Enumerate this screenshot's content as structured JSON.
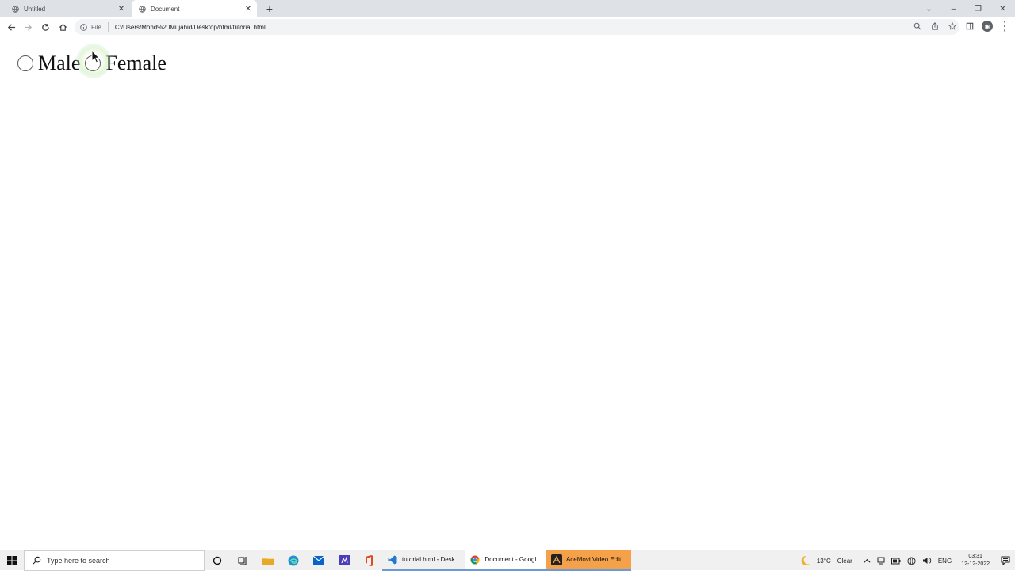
{
  "browser": {
    "tabs": [
      {
        "title": "Untitled",
        "active": false
      },
      {
        "title": "Document",
        "active": true
      }
    ],
    "address": {
      "scheme_label": "File",
      "url": "C:/Users/Mohd%20Mujahid/Desktop/html/tutorial.html"
    }
  },
  "page": {
    "radio_options": [
      {
        "label": "Male",
        "checked": false
      },
      {
        "label": "Female",
        "checked": false
      }
    ]
  },
  "taskbar": {
    "search_placeholder": "Type here to search",
    "apps": [
      {
        "label": "tutorial.html - Desk...",
        "icon": "vscode-icon"
      },
      {
        "label": "Document - Googl...",
        "icon": "chrome-icon"
      },
      {
        "label": "AceMovi Video Edit...",
        "icon": "acemovi-icon"
      }
    ],
    "weather": {
      "temp": "13°C",
      "condition": "Clear"
    },
    "lang": "ENG",
    "time": "03:31",
    "date": "12-12-2022"
  },
  "colors": {
    "tabstrip": "#dee1e6",
    "taskbar": "#f0f0f0",
    "active_app_accent": "#f5a14a"
  }
}
